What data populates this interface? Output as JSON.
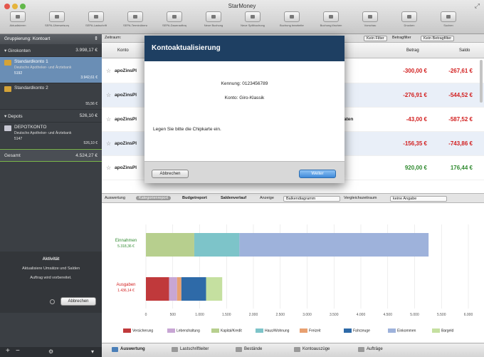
{
  "window": {
    "title": "StarMoney"
  },
  "toolbar": {
    "buttons": [
      {
        "label": "Aktualisieren"
      },
      {
        "label": "SEPA-Überweisung"
      },
      {
        "label": "SEPA-Lastschrift"
      },
      {
        "label": "SEPA-Terminüberweisung"
      },
      {
        "label": "SEPA-Dauerauftrag"
      },
      {
        "label": "Neue Buchung"
      },
      {
        "label": "Neue Splitbuchung"
      },
      {
        "label": "Buchung bearbeiten"
      },
      {
        "label": "Buchung löschen"
      },
      {
        "label": "Vorschau"
      },
      {
        "label": "Drucken"
      },
      {
        "label": "Suchen"
      }
    ]
  },
  "sidebar": {
    "header": "Gruppierung: Kontoart",
    "girokonten": {
      "label": "Girokonten",
      "amount": "3.998,17 €"
    },
    "accounts": [
      {
        "name": "Standardkonto 1",
        "bank": "Deutsche Apotheker- und Ärztebank",
        "number": "5192",
        "balance": "3.942,61 €"
      },
      {
        "name": "Standardkonto 2",
        "bank": "",
        "number": "",
        "balance": "55,56 €"
      }
    ],
    "depots": {
      "label": "Depots",
      "amount": "526,10 €"
    },
    "depot_account": {
      "name": "DEPOTKONTO",
      "bank": "Deutsche Apotheker- und Ärztebank",
      "number": "5147",
      "balance": "526,10 €"
    },
    "total": {
      "label": "Gesamt",
      "amount": "4.524,27 €"
    },
    "activity": {
      "title": "Aktivität",
      "line1": "Aktualisiere Umsätze und Salden",
      "line2": "Auftrag wird vorbereitet.",
      "cancel": "Abbrechen"
    }
  },
  "filterbar": {
    "zeitraum": "Zeitraum:",
    "kein_filter": "Kein Filter",
    "betragfilter": "Betragfilter",
    "kein_betragfilter": "Kein Betragfilter"
  },
  "table": {
    "headers": {
      "konto": "Konto",
      "betrag": "Betrag",
      "saldo": "Saldo"
    },
    "rows": [
      {
        "konto": "apoZinsPl",
        "mid": "",
        "betrag": "-300,00 €",
        "saldo": "-267,61 €",
        "sign_betrag": "neg",
        "sign_saldo": "neg"
      },
      {
        "konto": "apoZinsPl",
        "mid": "",
        "betrag": "-276,91 €",
        "saldo": "-544,52 €",
        "sign_betrag": "neg",
        "sign_saldo": "neg"
      },
      {
        "konto": "apoZinsPl",
        "mid": "aten",
        "betrag": "-43,00 €",
        "saldo": "-587,52 €",
        "sign_betrag": "neg",
        "sign_saldo": "neg"
      },
      {
        "konto": "apoZinsPl",
        "mid": "",
        "betrag": "-156,35 €",
        "saldo": "-743,86 €",
        "sign_betrag": "neg",
        "sign_saldo": "neg"
      },
      {
        "konto": "apoZinsPl",
        "mid": "",
        "betrag": "920,00 €",
        "saldo": "176,44 €",
        "sign_betrag": "pos",
        "sign_saldo": "pos"
      }
    ]
  },
  "dialog": {
    "title": "Kontoaktualisierung",
    "kennung": "Kennung: 0123456789",
    "konto": "Konto: Giro-Klassik",
    "message": "Legen Sie bitte die Chipkarte ein.",
    "cancel": "Abbrechen",
    "ok": "Weiter"
  },
  "analysis_bar": {
    "auswertung": "Auswertung",
    "kategorienreport": "Kategorienreport",
    "budgetreport": "Budgetreport",
    "saldenverlauf": "Saldenverlauf",
    "anzeige": "Anzeige",
    "anzeige_value": "Balkendiagramm",
    "vergleichszeitraum": "Vergleichszeitraum",
    "vergleich_value": "keine Angabe"
  },
  "chart_data": {
    "type": "bar",
    "orientation": "horizontal-stacked",
    "categories": [
      {
        "label": "Einnahmen",
        "total": "5.318,36 €",
        "color": "#2f8a2f"
      },
      {
        "label": "Ausgaben",
        "total": "1.436,14 €",
        "color": "#d21f1f"
      }
    ],
    "series": [
      {
        "name": "Versicherung",
        "color": "#c0393b",
        "values": [
          0,
          430
        ]
      },
      {
        "name": "Lebenshaltung",
        "color": "#c8a6d4",
        "values": [
          0,
          150
        ]
      },
      {
        "name": "Kapital/Kredit",
        "color": "#b7cf8e",
        "values": [
          900,
          0
        ]
      },
      {
        "name": "Haus/Wohnung",
        "color": "#7dc4c9",
        "values": [
          840,
          0
        ]
      },
      {
        "name": "Freizeit",
        "color": "#e8a070",
        "values": [
          0,
          80
        ]
      },
      {
        "name": "Fahrzeuge",
        "color": "#2e6aa8",
        "values": [
          0,
          460
        ]
      },
      {
        "name": "Einkommen",
        "color": "#9eb2db",
        "values": [
          3520,
          0
        ]
      },
      {
        "name": "Bargeld",
        "color": "#c5e0a0",
        "values": [
          0,
          300
        ]
      }
    ],
    "xlim": [
      0,
      6000
    ],
    "xticks": [
      "0",
      "500",
      "1.000",
      "1.500",
      "2.000",
      "2.500",
      "3.000",
      "3.500",
      "4.000",
      "4.500",
      "5.000",
      "5.500",
      "6.000"
    ]
  },
  "tabs": [
    {
      "label": "Auswertung"
    },
    {
      "label": "Lastschriftleiter"
    },
    {
      "label": "Bestände"
    },
    {
      "label": "Kontoauszüge"
    },
    {
      "label": "Aufträge"
    }
  ]
}
